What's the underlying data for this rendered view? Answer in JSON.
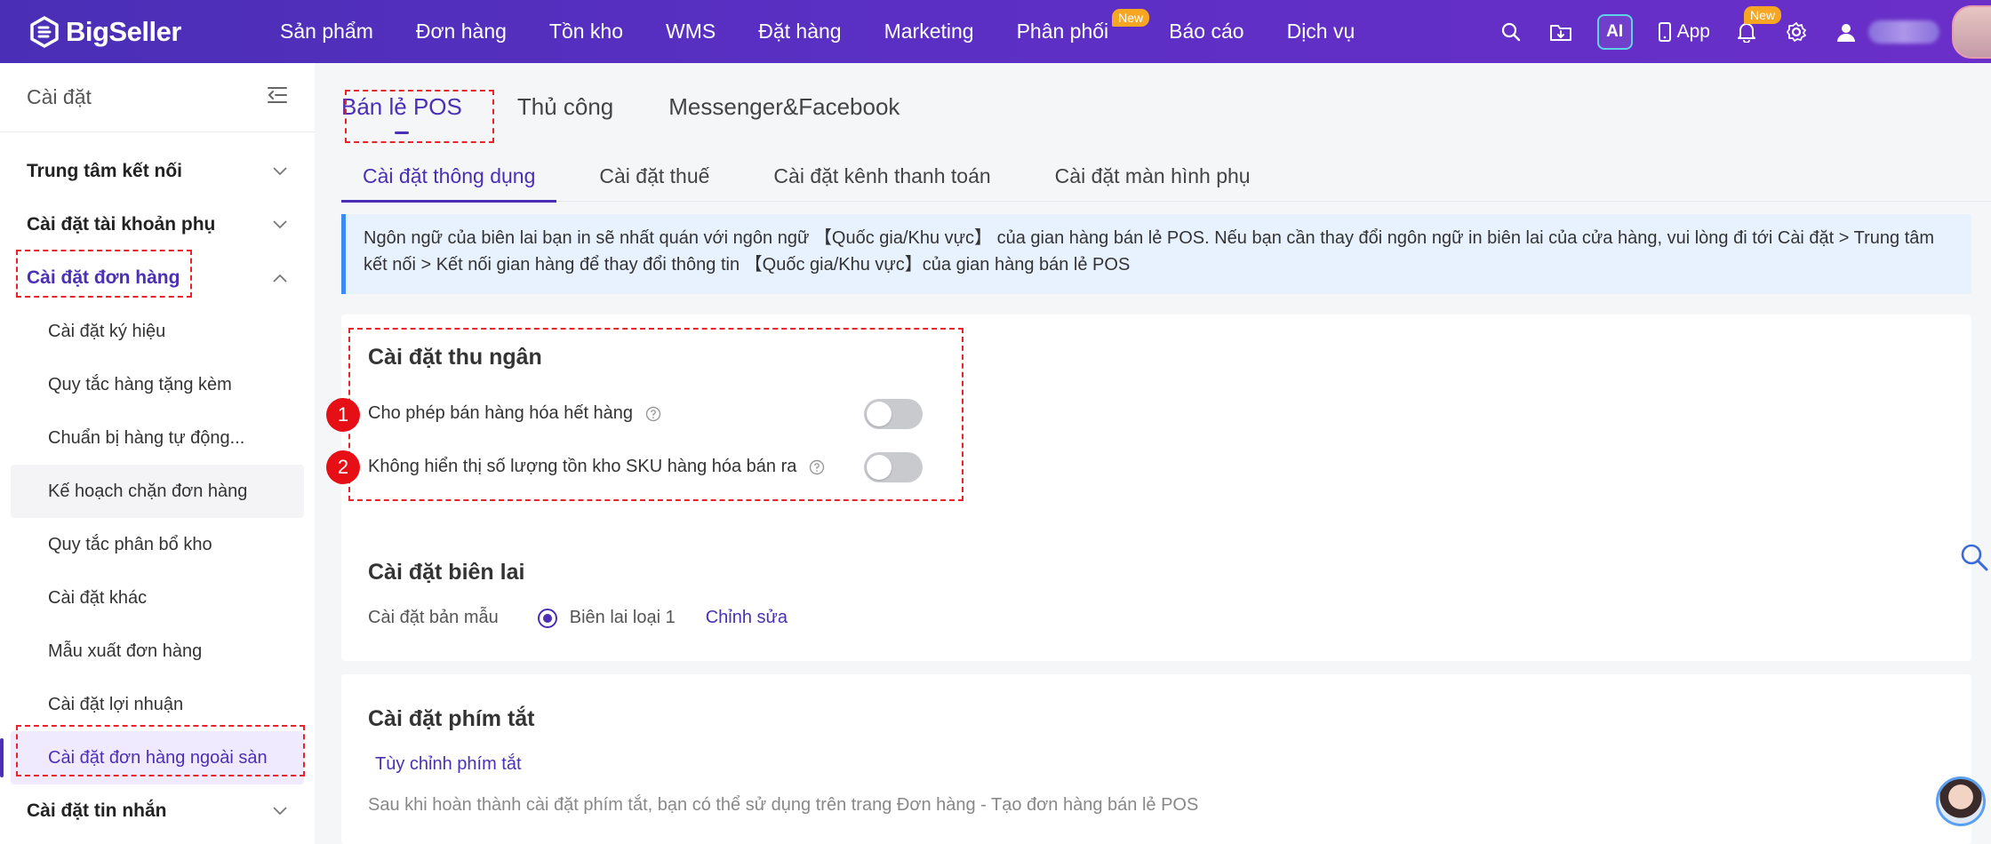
{
  "brand": {
    "name": "BigSeller"
  },
  "topnav": {
    "items": [
      {
        "label": "Sản phẩm"
      },
      {
        "label": "Đơn hàng"
      },
      {
        "label": "Tồn kho"
      },
      {
        "label": "WMS"
      },
      {
        "label": "Đặt hàng"
      },
      {
        "label": "Marketing"
      },
      {
        "label": "Phân phối",
        "badge": "New"
      },
      {
        "label": "Báo cáo"
      },
      {
        "label": "Dịch vụ"
      }
    ],
    "ai_label": "AI",
    "app_label": "App",
    "bell_badge": "New"
  },
  "sidebar": {
    "title": "Cài đặt",
    "groups": [
      {
        "label": "Trung tâm kết nối"
      },
      {
        "label": "Cài đặt tài khoản phụ"
      },
      {
        "label": "Cài đặt đơn hàng"
      },
      {
        "label": "Cài đặt tin nhắn"
      }
    ],
    "items": [
      {
        "label": "Cài đặt ký hiệu"
      },
      {
        "label": "Quy tắc hàng tặng kèm"
      },
      {
        "label": "Chuẩn bị hàng tự động..."
      },
      {
        "label": "Kế hoạch chặn đơn hàng"
      },
      {
        "label": "Quy tắc phân bổ kho"
      },
      {
        "label": "Cài đặt khác"
      },
      {
        "label": "Mẫu xuất đơn hàng"
      },
      {
        "label": "Cài đặt lợi nhuận"
      },
      {
        "label": "Cài đặt đơn hàng ngoài sàn"
      }
    ]
  },
  "main": {
    "tabs": [
      {
        "label": "Bán lẻ POS"
      },
      {
        "label": "Thủ công"
      },
      {
        "label": "Messenger&Facebook"
      }
    ],
    "subtabs": [
      {
        "label": "Cài đặt thông dụng"
      },
      {
        "label": "Cài đặt thuế"
      },
      {
        "label": "Cài đặt kênh thanh toán"
      },
      {
        "label": "Cài đặt màn hình phụ"
      }
    ],
    "notice": "Ngôn ngữ của biên lai bạn in sẽ nhất quán với ngôn ngữ 【Quốc gia/Khu vực】 của gian hàng bán lẻ POS. Nếu bạn cần thay đổi ngôn ngữ in biên lai của cửa hàng, vui lòng đi tới Cài đặt > Trung tâm kết nối > Kết nối gian hàng để thay đổi thông tin 【Quốc gia/Khu vực】của gian hàng bán lẻ POS",
    "cashier": {
      "title": "Cài đặt thu ngân",
      "settings": [
        {
          "number": "1",
          "label": "Cho phép bán hàng hóa hết hàng",
          "enabled": false
        },
        {
          "number": "2",
          "label": "Không hiển thị số lượng tồn kho SKU hàng hóa bán ra",
          "enabled": false
        }
      ]
    },
    "receipt": {
      "title": "Cài đặt biên lai",
      "template_label": "Cài đặt bản mẫu",
      "template_option": "Biên lai loại 1",
      "edit_label": "Chỉnh sửa"
    },
    "shortcut": {
      "title": "Cài đặt phím tắt",
      "customize_label": "Tùy chỉnh phím tắt",
      "description": "Sau khi hoàn thành cài đặt phím tắt, bạn có thể sử dụng trên trang Đơn hàng - Tạo đơn hàng bán lẻ POS"
    }
  },
  "colors": {
    "brand_purple": "#4b2fb5",
    "nav_gradient_start": "#4a2fb6",
    "nav_gradient_end": "#6a2fc8",
    "badge_orange": "#f6a623",
    "annotation_red": "#e8232a",
    "notice_bg": "#e8f2fe",
    "notice_border": "#3c8bf5"
  },
  "icons": {
    "logo": "bigseller-logo-icon",
    "search": "search-icon",
    "download_folder": "folder-download-icon",
    "phone": "phone-icon",
    "bell": "bell-icon",
    "settings": "gear-icon",
    "user": "user-icon",
    "collapse": "collapse-menu-icon",
    "chevron_down": "chevron-down-icon",
    "chevron_up": "chevron-up-icon",
    "help": "help-circle-icon"
  }
}
